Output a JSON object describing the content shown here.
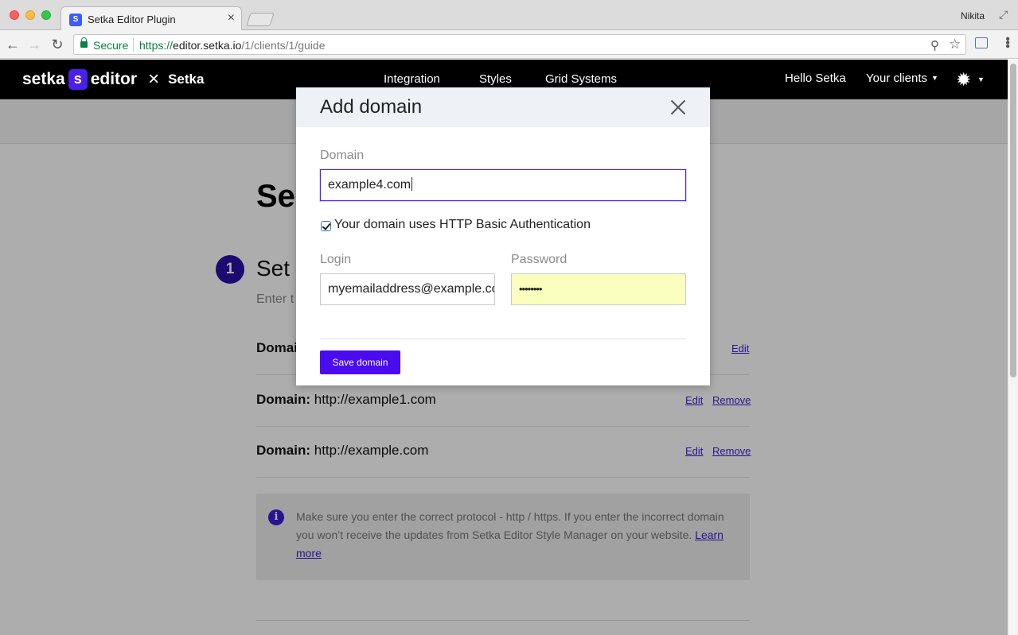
{
  "browser": {
    "tab_title": "Setka Editor Plugin",
    "tab_close": "×",
    "profile_name": "Nikita",
    "secure_label": "Secure",
    "url_scheme": "https://",
    "url_host": "editor.setka.io",
    "url_path": "/1/clients/1/guide",
    "icons": [
      "back-icon",
      "forward-icon",
      "reload-icon",
      "lock-icon",
      "key-icon",
      "star-icon",
      "extension-icon",
      "menu-icon"
    ]
  },
  "site_nav": {
    "logo_left": "setka",
    "logo_mark": "s",
    "logo_right": "editor",
    "logo_times": "×",
    "client_name": "Setka",
    "links": [
      "Integration",
      "Styles",
      "Grid Systems"
    ],
    "greeting": "Hello Setka",
    "clients_menu": "Your clients"
  },
  "page": {
    "heading_visible": "Se",
    "step_number": "1",
    "step_title_visible": "Set",
    "step_sub_visible": "Enter t",
    "domains": [
      {
        "label": "Domai",
        "value": "",
        "actions": [
          "Edit"
        ]
      },
      {
        "label": "Domain:",
        "value": "http://example1.com",
        "actions": [
          "Edit",
          "Remove"
        ]
      },
      {
        "label": "Domain:",
        "value": "http://example.com",
        "actions": [
          "Edit",
          "Remove"
        ]
      }
    ],
    "info_text": "Make sure you enter the correct protocol - http / https. If you enter the incorrect domain you won’t receive the updates from Setka Editor Style Manager on your website.",
    "info_link": "Learn more"
  },
  "modal": {
    "title": "Add domain",
    "domain_label": "Domain",
    "domain_value": "example4.com",
    "basic_auth_label": "Your domain uses HTTP Basic Authentication",
    "basic_auth_checked": true,
    "login_label": "Login",
    "login_value": "myemailaddress@example.com",
    "password_label": "Password",
    "password_value": "••••••••",
    "save_label": "Save domain"
  },
  "colors": {
    "brand_purple": "#4b0bef",
    "link_purple": "#3b1fd0",
    "step_badge": "#2b0fa5",
    "autofill_yellow": "#faffbd",
    "nav_black": "#000000"
  }
}
